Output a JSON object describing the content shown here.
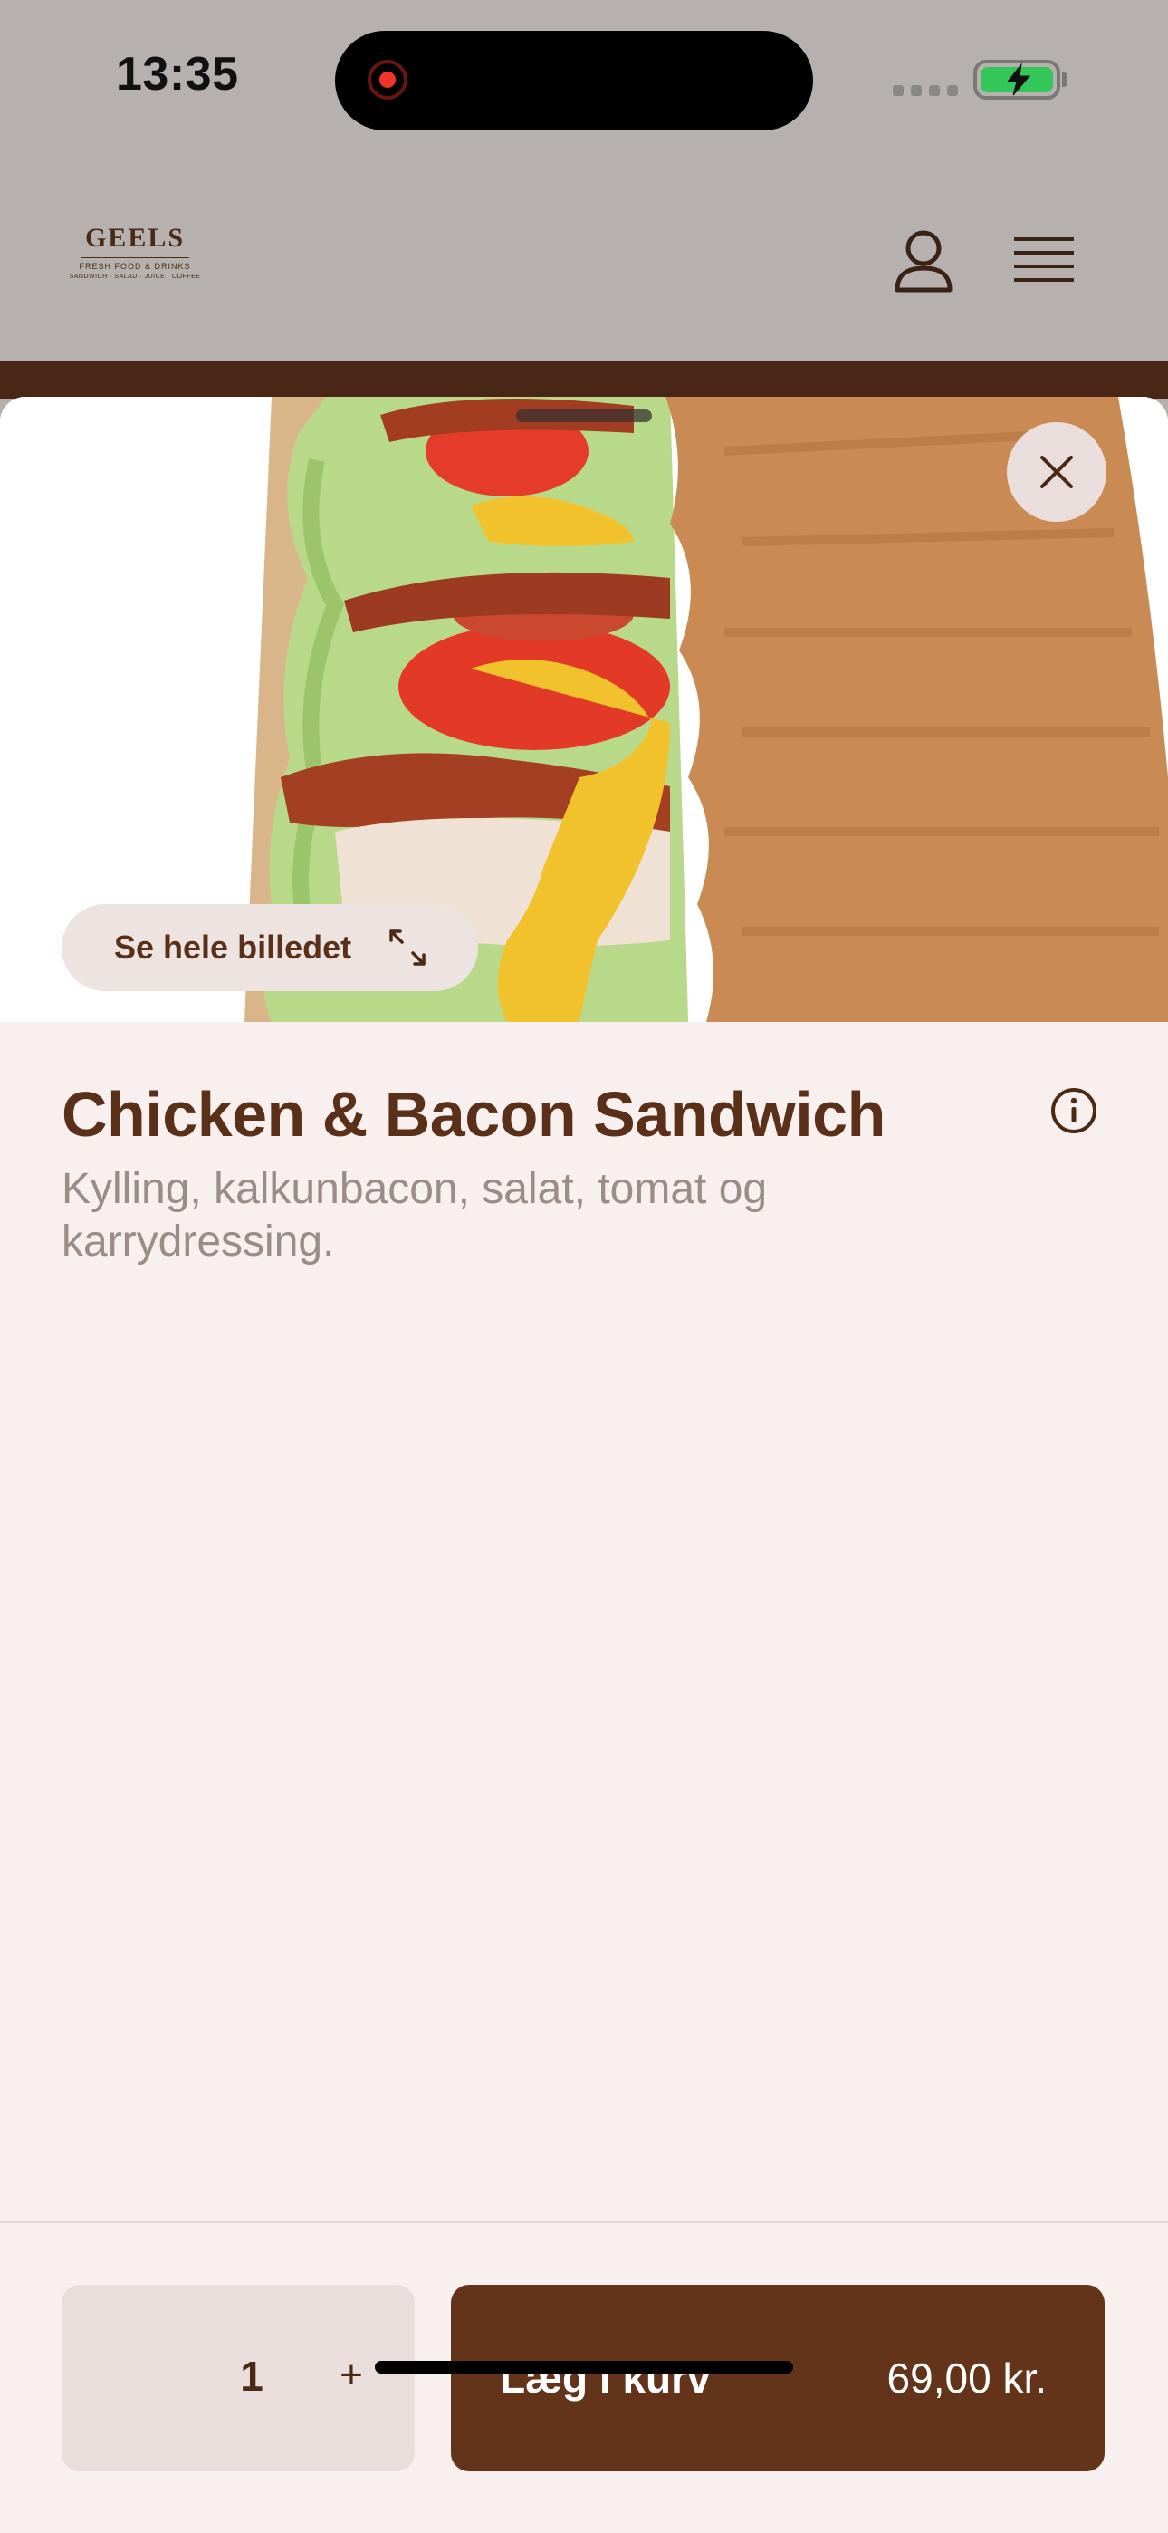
{
  "status_bar": {
    "time": "13:35",
    "icons": [
      "recording-indicator",
      "cellular-signal-icon",
      "battery-charging-icon"
    ],
    "battery_color": "#33c759"
  },
  "header": {
    "logo": {
      "name": "GEELS",
      "tagline_1": "FRESH FOOD & DRINKS",
      "tagline_2": "SANDWICH · SALAD · JUICE · COFFEE"
    },
    "icons": [
      "user-profile-icon",
      "hamburger-menu-icon"
    ]
  },
  "product": {
    "see_full_image_label": "Se hele billedet",
    "title": "Chicken & Bacon Sandwich",
    "description": "Kylling, kalkunbacon, salat, tomat og karrydressing."
  },
  "footer": {
    "quantity": "1",
    "plus_label": "+",
    "add_to_cart_label": "Læg i kurv",
    "price": "69,00 kr."
  },
  "colors": {
    "brand_brown": "#633419",
    "title_brown": "#5a3018",
    "sheet_background": "#f8f0ee"
  }
}
